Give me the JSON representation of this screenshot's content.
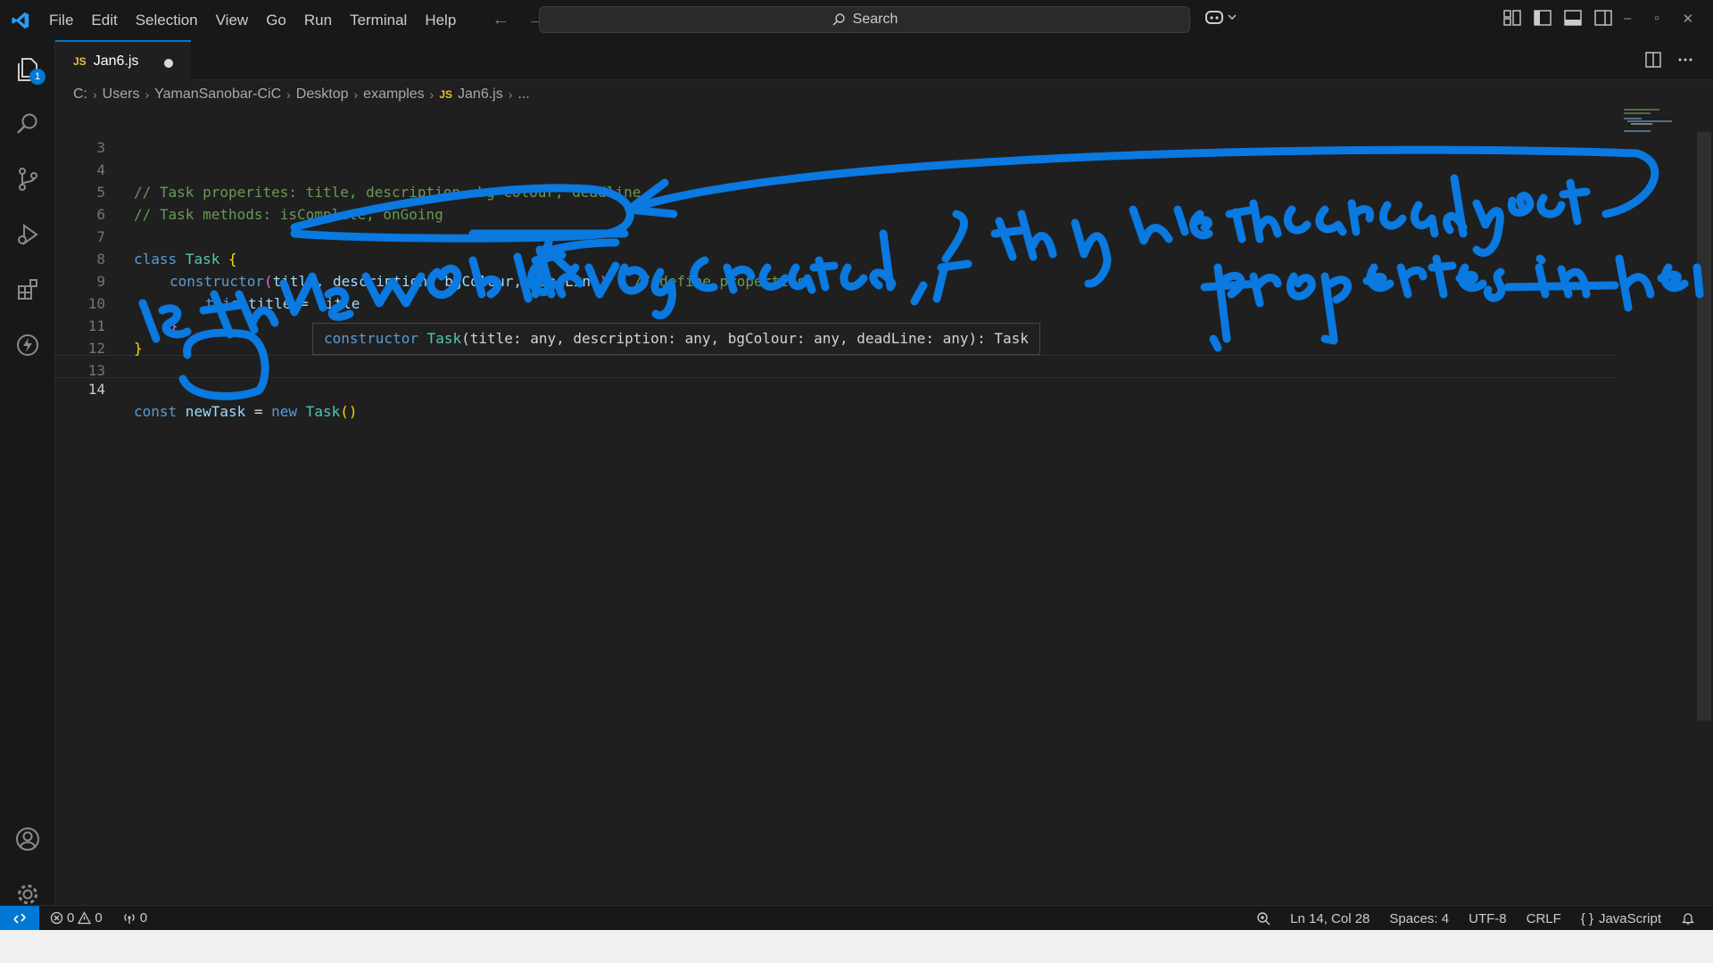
{
  "menu": [
    "File",
    "Edit",
    "Selection",
    "View",
    "Go",
    "Run",
    "Terminal",
    "Help"
  ],
  "search": {
    "label": "Search"
  },
  "activity": {
    "explorer_badge": "1"
  },
  "tab": {
    "icon": "JS",
    "name": "Jan6.js"
  },
  "breadcrumb": [
    "C:",
    "Users",
    "YamanSanobar-CiC",
    "Desktop",
    "examples",
    "Jan6.js",
    "..."
  ],
  "breadcrumb_file_icon": "JS",
  "lines": {
    "n3": "3",
    "n4": "4",
    "n5": "5",
    "n6": "6",
    "n7": "7",
    "n8": "8",
    "n9": "9",
    "n10": "10",
    "n11": "11",
    "n12": "12",
    "n13": "13",
    "n14": "14",
    "l4": "// Task properites: title, description, bg Colour, deadline",
    "l5": "// Task methods: isComplete, onGoing",
    "l7_kw": "class",
    "l7_name": " Task",
    "l7_brace": " {",
    "l8_ctor": "constructor",
    "l8_open": "(",
    "l8_params": "title, description, bgColour, deadLine",
    "l8_close": ")",
    "l8_brace": " {",
    "l8_comment": " // define properties",
    "l9_this": "this",
    "l9_rest": ".title = title",
    "l10": "}",
    "l11": "}",
    "l14_kw": "const",
    "l14_var": " newTask",
    "l14_eq": " = ",
    "l14_new": "new",
    "l14_cls": " Task",
    "l14_parens": "()"
  },
  "hover": {
    "kw": "constructor",
    "cls": " Task",
    "sig": "(title: any, description: any, bgColour: any, deadLine: any): Task"
  },
  "status": {
    "errors": "0",
    "warnings": "0",
    "ports": "0",
    "position": "Ln 14, Col 28",
    "spaces": "Spaces: 4",
    "encoding": "UTF-8",
    "eol": "CRLF",
    "language": "JavaScript"
  },
  "colors": {
    "accent": "#0078d4",
    "ink": "#0a79e0",
    "editor_bg": "#1f1f1f"
  }
}
